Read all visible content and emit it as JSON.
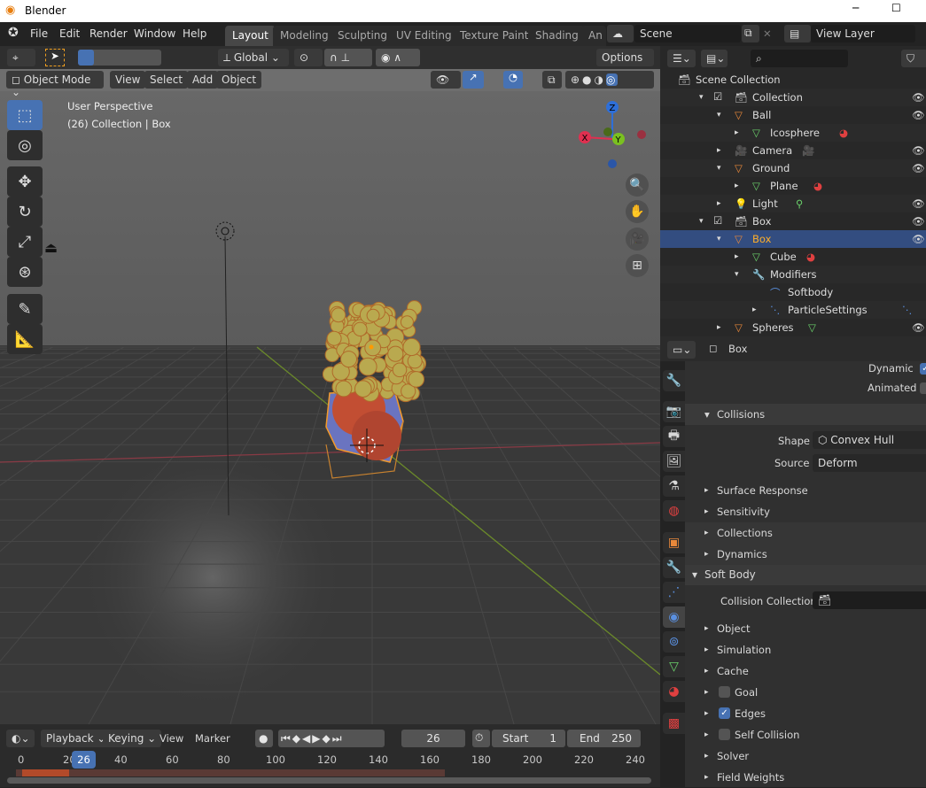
{
  "window": {
    "title": "Blender",
    "minimize": "─",
    "maximize": "☐"
  },
  "menus": [
    "File",
    "Edit",
    "Render",
    "Window",
    "Help"
  ],
  "workspaces": [
    "Layout",
    "Modeling",
    "Sculpting",
    "UV Editing",
    "Texture Paint",
    "Shading",
    "An"
  ],
  "active_workspace": "Layout",
  "scene": "Scene",
  "view_layer": "View Layer",
  "tool_header": {
    "orientation": "Global",
    "options": "Options"
  },
  "viewport_header": {
    "mode": "Object Mode",
    "menus": [
      "View",
      "Select",
      "Add",
      "Object"
    ]
  },
  "viewport": {
    "perspective": "User Perspective",
    "context": "(26) Collection | Box",
    "gizmo": {
      "x": "X",
      "y": "Y",
      "z": "Z"
    }
  },
  "outliner": {
    "search_placeholder": "",
    "rows": [
      {
        "label": "Scene Collection",
        "type": "collection"
      },
      {
        "label": "Collection",
        "type": "collection"
      },
      {
        "label": "Ball",
        "type": "object"
      },
      {
        "label": "Icosphere",
        "type": "mesh"
      },
      {
        "label": "Camera",
        "type": "camera"
      },
      {
        "label": "Ground",
        "type": "object"
      },
      {
        "label": "Plane",
        "type": "mesh"
      },
      {
        "label": "Light",
        "type": "light"
      },
      {
        "label": "Box",
        "type": "collection"
      },
      {
        "label": "Box",
        "type": "object",
        "selected": true
      },
      {
        "label": "Cube",
        "type": "mesh"
      },
      {
        "label": "Modifiers",
        "type": "modifiers"
      },
      {
        "label": "Softbody",
        "type": "modifier"
      },
      {
        "label": "ParticleSettings",
        "type": "particles"
      },
      {
        "label": "Spheres",
        "type": "object"
      }
    ]
  },
  "properties": {
    "object": "Box",
    "dynamic_label": "Dynamic",
    "dynamic": true,
    "animated_label": "Animated",
    "animated": false,
    "collisions": "Collisions",
    "shape_label": "Shape",
    "shape": "Convex Hull",
    "source_label": "Source",
    "source": "Deform",
    "sub": [
      "Surface Response",
      "Sensitivity",
      "Collections",
      "Dynamics"
    ],
    "soft_body": "Soft Body",
    "collision_collection_label": "Collision Collection",
    "sb_sub": [
      "Object",
      "Simulation",
      "Cache"
    ],
    "goal": "Goal",
    "goal_on": false,
    "edges": "Edges",
    "edges_on": true,
    "self_collision": "Self Collision",
    "self_collision_on": false,
    "sb_sub2": [
      "Solver",
      "Field Weights"
    ]
  },
  "timeline": {
    "menus": [
      "Playback",
      "Keying",
      "View",
      "Marker"
    ],
    "current_frame": "26",
    "start_label": "Start",
    "start": "1",
    "end_label": "End",
    "end": "250",
    "ticks": [
      "0",
      "20",
      "40",
      "60",
      "80",
      "100",
      "120",
      "140",
      "160",
      "180",
      "200",
      "220",
      "240"
    ]
  },
  "colors": {
    "accent": "#4772b3",
    "selected_text": "#ffaf29",
    "object_orange": "#e8883a",
    "mesh_green": "#6bd26b"
  }
}
